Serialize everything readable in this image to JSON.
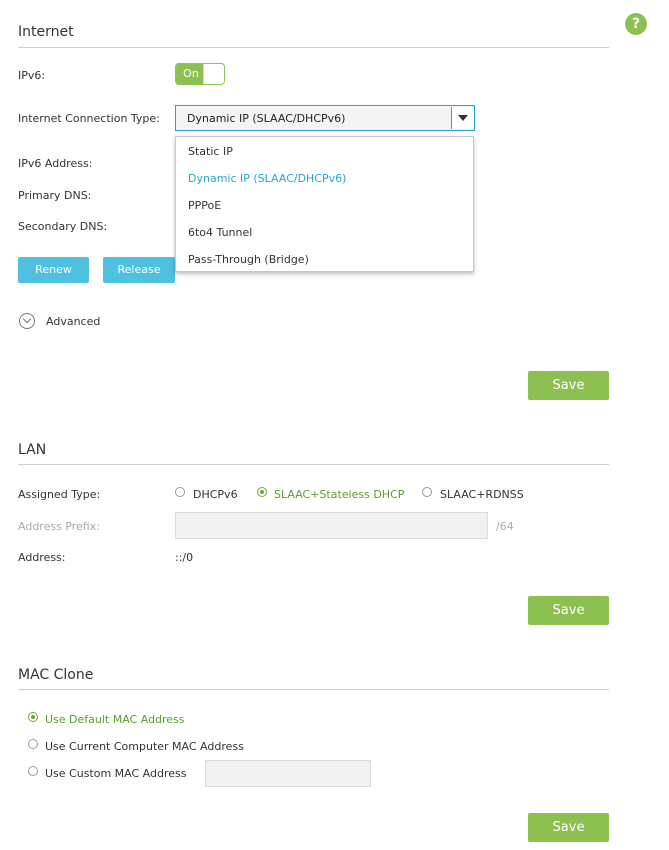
{
  "help": {
    "glyph": "?"
  },
  "internet": {
    "title": "Internet",
    "ipv6_label": "IPv6:",
    "ipv6_toggle": "On",
    "conn_type_label": "Internet Connection Type:",
    "conn_type_value": "Dynamic IP (SLAAC/DHCPv6)",
    "dropdown_options": [
      "Static IP",
      "Dynamic IP (SLAAC/DHCPv6)",
      "PPPoE",
      "6to4 Tunnel",
      "Pass-Through (Bridge)"
    ],
    "ipv6_address_label": "IPv6 Address:",
    "primary_dns_label": "Primary DNS:",
    "secondary_dns_label": "Secondary DNS:",
    "renew_label": "Renew",
    "release_label": "Release",
    "advanced_label": "Advanced",
    "save_label": "Save"
  },
  "lan": {
    "title": "LAN",
    "assigned_type_label": "Assigned Type:",
    "options": [
      "DHCPv6",
      "SLAAC+Stateless DHCP",
      "SLAAC+RDNSS"
    ],
    "selected_option": "SLAAC+Stateless DHCP",
    "address_prefix_label": "Address Prefix:",
    "address_prefix_value": "",
    "prefix_suffix": "/64",
    "address_label": "Address:",
    "address_value": "::/0",
    "save_label": "Save"
  },
  "mac": {
    "title": "MAC Clone",
    "options": [
      "Use Default MAC Address",
      "Use Current Computer MAC Address",
      "Use Custom MAC Address"
    ],
    "selected_option": "Use Default MAC Address",
    "custom_value": "",
    "save_label": "Save"
  },
  "colors": {
    "accent_green": "#8cc152",
    "accent_blue": "#2aa3d0",
    "button_blue": "#4fc1e0"
  }
}
